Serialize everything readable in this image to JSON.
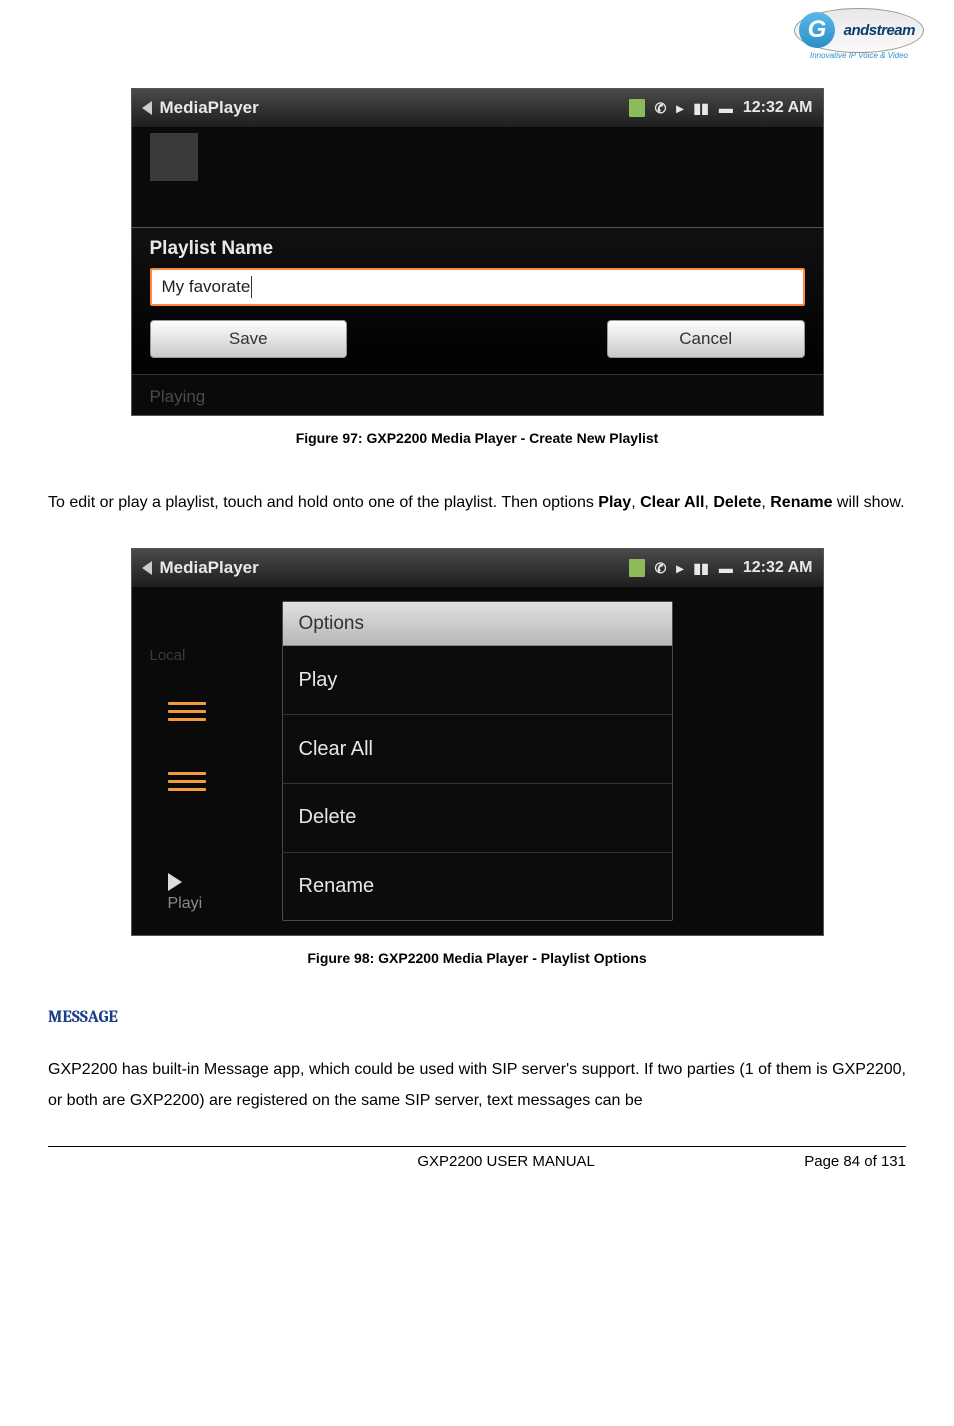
{
  "logo": {
    "brand": "andstream",
    "g": "G",
    "tagline": "Innovative IP Voice & Video"
  },
  "screenshot1": {
    "title": "MediaPlayer",
    "time": "12:32 AM",
    "panel_label": "Playlist Name",
    "input_value": "My favorate",
    "save_btn": "Save",
    "cancel_btn": "Cancel",
    "bottom_text": "Playing"
  },
  "caption1": "Figure 97: GXP2200 Media Player - Create New Playlist",
  "paragraph1_pre": "To edit or play a playlist, touch and hold onto one of the playlist. Then options ",
  "paragraph1_opts": {
    "play": "Play",
    "clear": "Clear All",
    "delete": "Delete",
    "rename": "Rename"
  },
  "paragraph1_post": " will show.",
  "screenshot2": {
    "title": "MediaPlayer",
    "time": "12:32 AM",
    "menu_header": "Options",
    "items": [
      "Play",
      "Clear All",
      "Delete",
      "Rename"
    ],
    "side_local": "Local",
    "side_play": "Playi"
  },
  "caption2": "Figure 98: GXP2200 Media Player - Playlist Options",
  "section_heading": "MESSAGE",
  "paragraph2": "GXP2200 has built-in Message app, which could be used with SIP server's support. If two parties (1 of them is GXP2200, or both are GXP2200) are registered on the same SIP server, text messages can be",
  "footer": {
    "title": "GXP2200 USER MANUAL",
    "page": "Page 84 of 131"
  }
}
